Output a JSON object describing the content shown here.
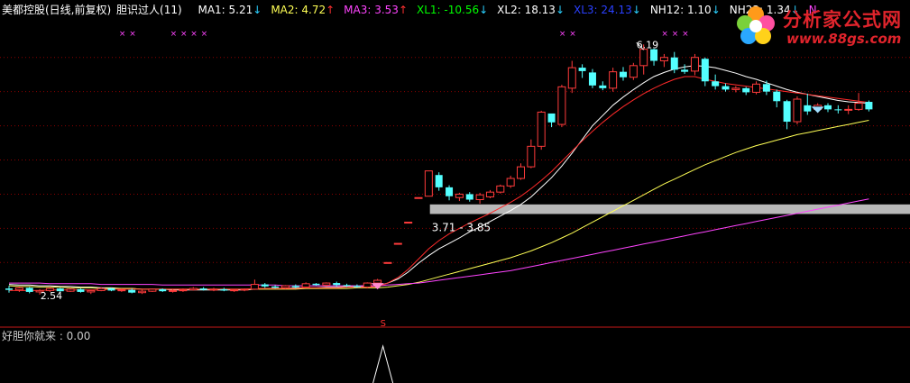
{
  "header": {
    "stock_label": "美都控股(日线,前复权)",
    "formula_label": "胆识过人(11)",
    "indicators": [
      {
        "label": "MA1: 5.21",
        "arrow": "↓",
        "color": "#ffffff",
        "arrow_color": "#2ad0ff"
      },
      {
        "label": "MA2: 4.72",
        "arrow": "↑",
        "color": "#ffff55",
        "arrow_color": "#ff3030"
      },
      {
        "label": "MA3: 3.53",
        "arrow": "↑",
        "color": "#ff44ff",
        "arrow_color": "#ff3030"
      },
      {
        "label": "XL1: -10.56",
        "arrow": "↓",
        "color": "#00ff00",
        "arrow_color": "#2ad0ff"
      },
      {
        "label": "XL2: 18.13",
        "arrow": "↓",
        "color": "#ffffff",
        "arrow_color": "#2ad0ff"
      },
      {
        "label": "XL3: 24.13",
        "arrow": "↓",
        "color": "#2a40ff",
        "arrow_color": "#2ad0ff"
      },
      {
        "label": "NH12: 1.10",
        "arrow": "↓",
        "color": "#ffffff",
        "arrow_color": "#2ad0ff"
      },
      {
        "label": "NH23: 1.34",
        "arrow": "↓",
        "color": "#ffffff",
        "arrow_color": "#2ad0ff"
      },
      {
        "label": "N",
        "arrow": "",
        "color": "#ff44ff",
        "arrow_color": "#2ad0ff"
      }
    ]
  },
  "logo": {
    "title": "分析家公式网",
    "url": "www.88gs.com"
  },
  "sub_panel": {
    "label": "好胆你就来 : 0.00"
  },
  "chart_data": {
    "type": "candlestick",
    "annotations": {
      "high_label": "6.19",
      "low_label": "2.54",
      "range_label": "3.71 - 3.85",
      "band": [
        3.71,
        3.85
      ],
      "signal_mark": "S"
    },
    "ylim": [
      2.2,
      6.55
    ],
    "candles": [
      [
        2.62,
        2.66,
        2.56,
        2.6
      ],
      [
        2.6,
        2.65,
        2.57,
        2.63
      ],
      [
        2.63,
        2.64,
        2.55,
        2.57
      ],
      [
        2.57,
        2.61,
        2.53,
        2.59
      ],
      [
        2.59,
        2.64,
        2.57,
        2.62
      ],
      [
        2.62,
        2.63,
        2.57,
        2.58
      ],
      [
        2.58,
        2.63,
        2.57,
        2.61
      ],
      [
        2.61,
        2.62,
        2.56,
        2.57
      ],
      [
        2.57,
        2.6,
        2.54,
        2.59
      ],
      [
        2.59,
        2.64,
        2.58,
        2.62
      ],
      [
        2.62,
        2.63,
        2.58,
        2.59
      ],
      [
        2.59,
        2.62,
        2.57,
        2.6
      ],
      [
        2.6,
        2.62,
        2.55,
        2.56
      ],
      [
        2.56,
        2.6,
        2.54,
        2.58
      ],
      [
        2.58,
        2.62,
        2.57,
        2.61
      ],
      [
        2.61,
        2.62,
        2.57,
        2.58
      ],
      [
        2.58,
        2.61,
        2.56,
        2.59
      ],
      [
        2.59,
        2.62,
        2.57,
        2.6
      ],
      [
        2.6,
        2.64,
        2.59,
        2.62
      ],
      [
        2.62,
        2.64,
        2.59,
        2.6
      ],
      [
        2.6,
        2.63,
        2.58,
        2.61
      ],
      [
        2.61,
        2.63,
        2.58,
        2.59
      ],
      [
        2.59,
        2.61,
        2.57,
        2.6
      ],
      [
        2.6,
        2.62,
        2.58,
        2.61
      ],
      [
        2.61,
        2.75,
        2.6,
        2.68
      ],
      [
        2.68,
        2.7,
        2.63,
        2.65
      ],
      [
        2.65,
        2.67,
        2.62,
        2.63
      ],
      [
        2.63,
        2.67,
        2.61,
        2.66
      ],
      [
        2.66,
        2.68,
        2.62,
        2.64
      ],
      [
        2.64,
        2.71,
        2.63,
        2.69
      ],
      [
        2.69,
        2.7,
        2.66,
        2.67
      ],
      [
        2.67,
        2.71,
        2.65,
        2.7
      ],
      [
        2.7,
        2.72,
        2.65,
        2.67
      ],
      [
        2.67,
        2.69,
        2.64,
        2.66
      ],
      [
        2.66,
        2.68,
        2.63,
        2.64
      ],
      [
        2.64,
        2.71,
        2.62,
        2.7
      ],
      [
        2.7,
        2.76,
        2.68,
        2.74
      ],
      [
        3.0,
        3.0,
        3.0,
        3.0
      ],
      [
        3.28,
        3.28,
        3.28,
        3.28
      ],
      [
        3.59,
        3.59,
        3.59,
        3.59
      ],
      [
        3.95,
        3.95,
        3.95,
        3.95
      ],
      [
        3.97,
        4.34,
        3.97,
        4.34
      ],
      [
        4.28,
        4.32,
        4.05,
        4.1
      ],
      [
        4.1,
        4.13,
        3.91,
        3.97
      ],
      [
        3.95,
        4.02,
        3.9,
        4.0
      ],
      [
        4.0,
        4.03,
        3.89,
        3.92
      ],
      [
        3.92,
        4.02,
        3.86,
        3.99
      ],
      [
        3.96,
        4.06,
        3.94,
        4.03
      ],
      [
        4.03,
        4.14,
        4.01,
        4.12
      ],
      [
        4.12,
        4.27,
        4.09,
        4.23
      ],
      [
        4.23,
        4.45,
        4.21,
        4.4
      ],
      [
        4.4,
        4.8,
        4.38,
        4.7
      ],
      [
        4.7,
        5.22,
        4.65,
        5.2
      ],
      [
        5.18,
        5.15,
        4.98,
        5.05
      ],
      [
        5.02,
        5.6,
        4.98,
        5.57
      ],
      [
        5.55,
        5.95,
        5.48,
        5.85
      ],
      [
        5.85,
        5.9,
        5.7,
        5.8
      ],
      [
        5.78,
        5.83,
        5.55,
        5.59
      ],
      [
        5.59,
        5.65,
        5.52,
        5.55
      ],
      [
        5.55,
        5.85,
        5.5,
        5.79
      ],
      [
        5.79,
        5.86,
        5.66,
        5.71
      ],
      [
        5.71,
        5.92,
        5.67,
        5.88
      ],
      [
        5.88,
        6.19,
        5.75,
        6.12
      ],
      [
        6.12,
        6.13,
        5.88,
        5.95
      ],
      [
        5.95,
        6.05,
        5.86,
        6.0
      ],
      [
        6.0,
        6.08,
        5.77,
        5.82
      ],
      [
        5.82,
        5.9,
        5.76,
        5.79
      ],
      [
        5.8,
        6.05,
        5.74,
        6.0
      ],
      [
        5.98,
        6.0,
        5.58,
        5.65
      ],
      [
        5.65,
        5.75,
        5.53,
        5.58
      ],
      [
        5.58,
        5.62,
        5.5,
        5.53
      ],
      [
        5.53,
        5.58,
        5.49,
        5.55
      ],
      [
        5.55,
        5.57,
        5.45,
        5.49
      ],
      [
        5.49,
        5.65,
        5.46,
        5.61
      ],
      [
        5.61,
        5.66,
        5.45,
        5.5
      ],
      [
        5.5,
        5.53,
        5.27,
        5.36
      ],
      [
        5.36,
        5.38,
        4.95,
        5.06
      ],
      [
        5.06,
        5.43,
        5.02,
        5.39
      ],
      [
        5.3,
        5.47,
        5.16,
        5.21
      ],
      [
        5.24,
        5.33,
        5.19,
        5.3
      ],
      [
        5.3,
        5.33,
        5.2,
        5.24
      ],
      [
        5.24,
        5.3,
        5.18,
        5.23
      ],
      [
        5.24,
        5.3,
        5.17,
        5.24
      ],
      [
        5.24,
        5.48,
        5.22,
        5.33
      ],
      [
        5.35,
        5.37,
        5.21,
        5.24
      ]
    ],
    "series": [
      {
        "name": "MA1",
        "color": "#ffffff",
        "values": [
          2.68,
          2.67,
          2.67,
          2.66,
          2.66,
          2.65,
          2.65,
          2.64,
          2.64,
          2.63,
          2.63,
          2.62,
          2.62,
          2.61,
          2.61,
          2.61,
          2.6,
          2.6,
          2.6,
          2.6,
          2.6,
          2.6,
          2.6,
          2.6,
          2.61,
          2.62,
          2.62,
          2.62,
          2.63,
          2.63,
          2.63,
          2.64,
          2.64,
          2.65,
          2.65,
          2.65,
          2.66,
          2.7,
          2.76,
          2.86,
          2.99,
          3.1,
          3.2,
          3.28,
          3.36,
          3.45,
          3.52,
          3.6,
          3.68,
          3.76,
          3.85,
          3.96,
          4.1,
          4.24,
          4.41,
          4.6,
          4.8,
          5.0,
          5.15,
          5.3,
          5.42,
          5.53,
          5.63,
          5.72,
          5.78,
          5.83,
          5.86,
          5.88,
          5.87,
          5.85,
          5.81,
          5.77,
          5.72,
          5.68,
          5.63,
          5.58,
          5.53,
          5.49,
          5.46,
          5.43,
          5.4,
          5.37,
          5.35,
          5.34,
          5.33
        ]
      },
      {
        "name": "MA2",
        "color": "#ffff55",
        "values": [
          2.66,
          2.65,
          2.65,
          2.64,
          2.64,
          2.64,
          2.63,
          2.63,
          2.63,
          2.62,
          2.62,
          2.62,
          2.62,
          2.61,
          2.61,
          2.61,
          2.61,
          2.61,
          2.61,
          2.61,
          2.61,
          2.61,
          2.61,
          2.61,
          2.61,
          2.61,
          2.61,
          2.61,
          2.61,
          2.62,
          2.62,
          2.62,
          2.62,
          2.62,
          2.63,
          2.63,
          2.63,
          2.64,
          2.66,
          2.68,
          2.71,
          2.75,
          2.79,
          2.83,
          2.87,
          2.91,
          2.95,
          2.99,
          3.03,
          3.07,
          3.12,
          3.17,
          3.23,
          3.29,
          3.36,
          3.43,
          3.51,
          3.59,
          3.67,
          3.75,
          3.83,
          3.91,
          3.99,
          4.07,
          4.15,
          4.22,
          4.29,
          4.36,
          4.43,
          4.49,
          4.55,
          4.61,
          4.66,
          4.71,
          4.75,
          4.79,
          4.83,
          4.87,
          4.9,
          4.93,
          4.96,
          4.99,
          5.02,
          5.05,
          5.08
        ]
      },
      {
        "name": "MA3",
        "color": "#ff44ff",
        "values": [
          2.7,
          2.7,
          2.7,
          2.7,
          2.69,
          2.69,
          2.69,
          2.69,
          2.69,
          2.68,
          2.68,
          2.68,
          2.68,
          2.68,
          2.68,
          2.67,
          2.67,
          2.67,
          2.67,
          2.67,
          2.67,
          2.67,
          2.67,
          2.67,
          2.67,
          2.67,
          2.67,
          2.66,
          2.66,
          2.66,
          2.66,
          2.66,
          2.66,
          2.66,
          2.66,
          2.66,
          2.66,
          2.67,
          2.68,
          2.69,
          2.7,
          2.72,
          2.74,
          2.76,
          2.78,
          2.8,
          2.82,
          2.84,
          2.86,
          2.88,
          2.91,
          2.94,
          2.97,
          3.0,
          3.03,
          3.06,
          3.09,
          3.12,
          3.15,
          3.18,
          3.21,
          3.24,
          3.27,
          3.3,
          3.33,
          3.36,
          3.39,
          3.42,
          3.45,
          3.48,
          3.51,
          3.54,
          3.57,
          3.6,
          3.63,
          3.66,
          3.69,
          3.72,
          3.75,
          3.78,
          3.81,
          3.84,
          3.87,
          3.9,
          3.93
        ]
      },
      {
        "name": "XL1",
        "color": "#ff2a2a",
        "values": [
          2.59,
          2.59,
          2.59,
          2.59,
          2.6,
          2.6,
          2.6,
          2.6,
          2.6,
          2.6,
          2.61,
          2.61,
          2.61,
          2.61,
          2.61,
          2.61,
          2.61,
          2.61,
          2.61,
          2.61,
          2.61,
          2.61,
          2.61,
          2.61,
          2.62,
          2.62,
          2.62,
          2.62,
          2.62,
          2.63,
          2.63,
          2.63,
          2.63,
          2.64,
          2.64,
          2.64,
          2.65,
          2.7,
          2.78,
          2.9,
          3.05,
          3.2,
          3.32,
          3.42,
          3.5,
          3.58,
          3.65,
          3.72,
          3.8,
          3.88,
          3.97,
          4.08,
          4.2,
          4.33,
          4.48,
          4.63,
          4.78,
          4.92,
          5.05,
          5.17,
          5.28,
          5.38,
          5.47,
          5.55,
          5.62,
          5.68,
          5.72,
          5.72,
          5.68,
          5.65,
          5.62,
          5.6,
          5.58,
          5.56,
          5.54,
          5.52,
          5.5,
          5.48,
          5.46,
          5.44,
          5.42,
          5.4,
          5.38,
          5.36,
          5.34
        ]
      }
    ],
    "gridlines": [
      6.0,
      5.5,
      5.0,
      4.5,
      4.0,
      3.5,
      3.0
    ],
    "x_marks": [
      11,
      12,
      16,
      17,
      18,
      19,
      54,
      55,
      64,
      65,
      66
    ],
    "low_index": 2,
    "high_index": 62,
    "signal_index": 36,
    "sub_spike_index": 36
  }
}
